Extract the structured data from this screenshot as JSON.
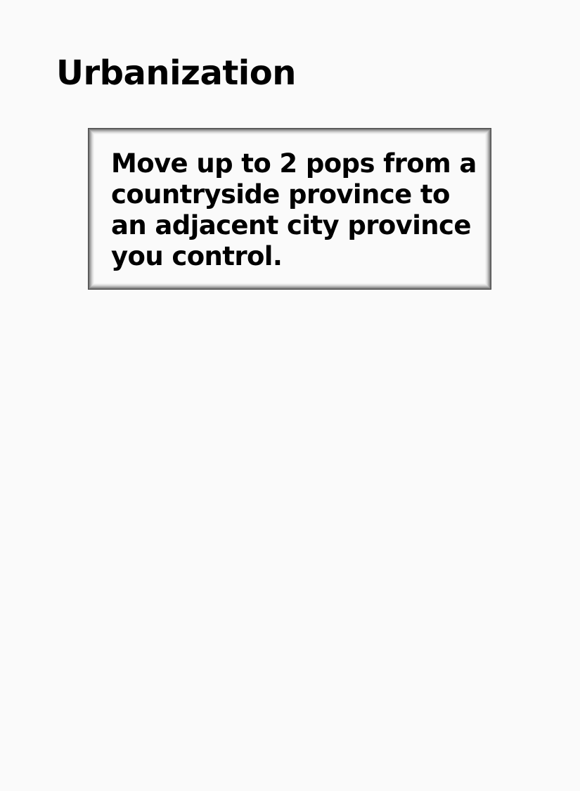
{
  "card": {
    "title": "Urbanization",
    "effect_text": "Move up to 2 pops from a countryside province to an adjacent city province you control."
  },
  "colors": {
    "background": "#fafafa",
    "text": "#000000",
    "frame_dark": "#4a4a4a"
  }
}
